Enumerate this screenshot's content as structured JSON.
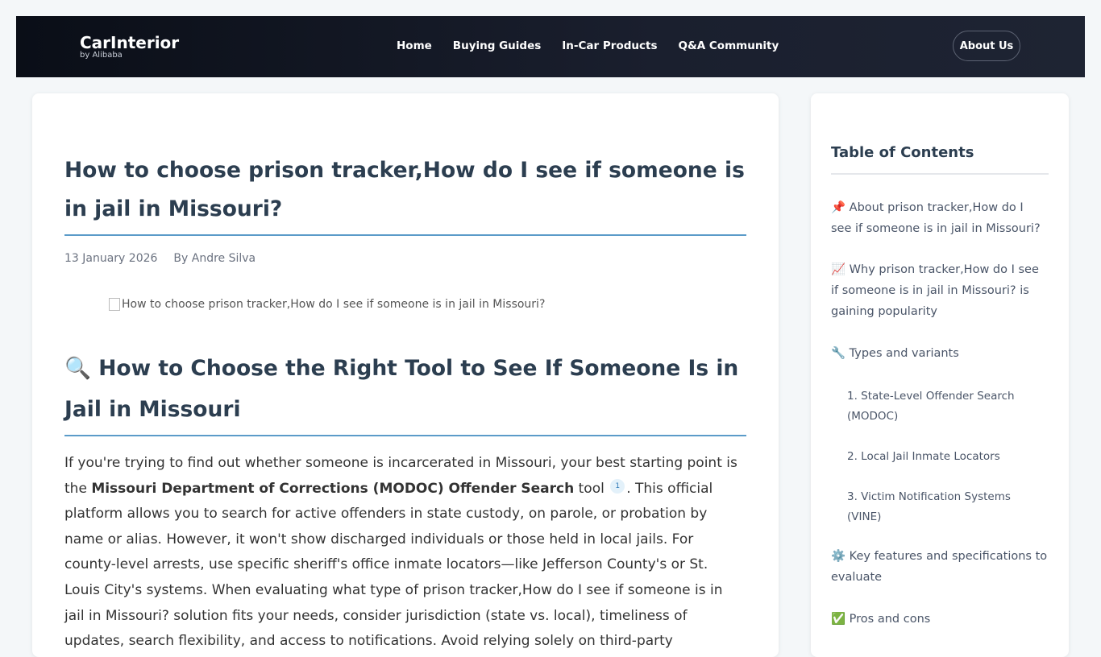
{
  "header": {
    "logo_name": "CarInterior",
    "logo_sub": "by Alibaba",
    "nav": [
      "Home",
      "Buying Guides",
      "In-Car Products",
      "Q&A Community"
    ],
    "about_label": "About Us"
  },
  "article": {
    "title": "How to choose prison tracker,How do I see if someone is in jail in Missouri?",
    "date": "13 January 2026",
    "author": "By Andre Silva",
    "image_alt": "How to choose prison tracker,How do I see if someone is in jail in Missouri?",
    "h2_icon": "🔍",
    "h2_text": "How to Choose the Right Tool to See If Someone Is in Jail in Missouri",
    "p1_start": "If you're trying to find out whether someone is incarcerated in Missouri, your best starting point is the ",
    "p1_bold": "Missouri Department of Corrections (MODOC) Offender Search",
    "p1_mid": " tool ",
    "p1_cite": "1",
    "p1_end": ". This official platform allows you to search for active offenders in state custody, on parole, or probation by name or alias. However, it won't show discharged individuals or those held in local jails. For county-level arrests, use specific sheriff's office inmate locators—like Jefferson County's or St. Louis City's systems. When evaluating what type of prison tracker,How do I see if someone is in jail in Missouri? solution fits your needs, consider jurisdiction (state vs. local), timeliness of updates, search flexibility, and access to notifications. Avoid relying solely on third-party"
  },
  "toc": {
    "title": "Table of Contents",
    "items": [
      {
        "icon": "📌",
        "label": "About prison tracker,How do I see if someone is in jail in Missouri?"
      },
      {
        "icon": "📈",
        "label": "Why prison tracker,How do I see if someone is in jail in Missouri? is gaining popularity"
      },
      {
        "icon": "🔧",
        "label": "Types and variants"
      },
      {
        "icon": "",
        "label": "1. State-Level Offender Search (MODOC)"
      },
      {
        "icon": "",
        "label": "2. Local Jail Inmate Locators"
      },
      {
        "icon": "",
        "label": "3. Victim Notification Systems (VINE)"
      },
      {
        "icon": "⚙️",
        "label": "Key features and specifications to evaluate"
      },
      {
        "icon": "✅",
        "label": "Pros and cons"
      }
    ]
  }
}
